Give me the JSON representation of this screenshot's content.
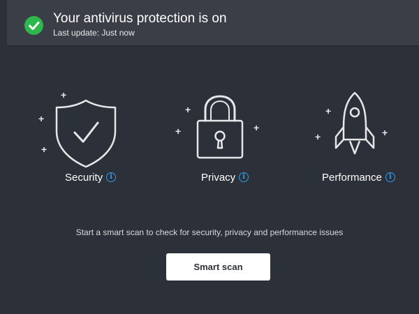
{
  "status": {
    "title": "Your antivirus protection is on",
    "subtitle": "Last update: Just now",
    "icon": "check-circle-icon",
    "color": "#2db84d"
  },
  "features": [
    {
      "label": "Security",
      "icon": "shield-check-icon",
      "info_icon": "info-icon"
    },
    {
      "label": "Privacy",
      "icon": "padlock-icon",
      "info_icon": "info-icon"
    },
    {
      "label": "Performance",
      "icon": "rocket-icon",
      "info_icon": "info-icon"
    }
  ],
  "hint": "Start a smart scan to check for security, privacy and performance issues",
  "actions": {
    "scan_label": "Smart scan"
  },
  "colors": {
    "background": "#2c3038",
    "header": "#393e47",
    "accent": "#2d9cf0",
    "button": "#ffffff"
  }
}
